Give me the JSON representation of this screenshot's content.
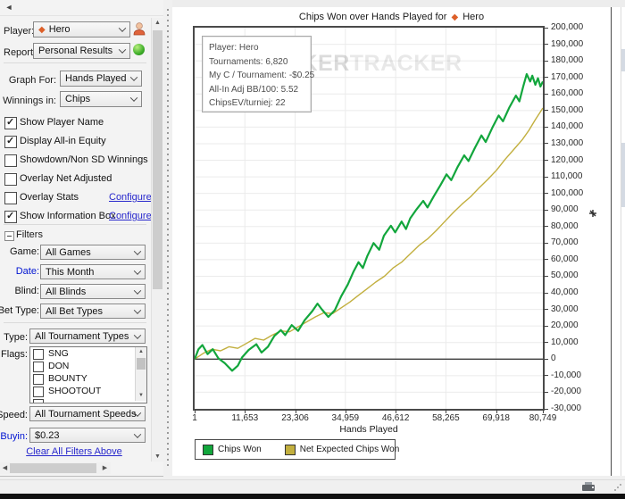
{
  "sidebar": {
    "collapse_button": "◄",
    "player": {
      "label": "Player:",
      "value": "Hero"
    },
    "report": {
      "label": "Report:",
      "value": "Personal Results"
    },
    "graph_for": {
      "label": "Graph For:",
      "value": "Hands Played"
    },
    "winnings_in": {
      "label": "Winnings in:",
      "value": "Chips"
    },
    "checkboxes": [
      {
        "label": "Show Player Name",
        "checked": true
      },
      {
        "label": "Display All-in Equity",
        "checked": true
      },
      {
        "label": "Showdown/Non SD Winnings",
        "checked": false
      },
      {
        "label": "Overlay Net Adjusted",
        "checked": false
      },
      {
        "label": "Overlay Stats",
        "checked": false,
        "link": "Configure"
      },
      {
        "label": "Show Information Box",
        "checked": true,
        "link": "Configure"
      }
    ],
    "filters": {
      "header": "Filters",
      "rows": [
        {
          "label": "Game:",
          "value": "All Games",
          "blue": false
        },
        {
          "label": "Date:",
          "value": "This Month",
          "blue": true
        },
        {
          "label": "Blind:",
          "value": "All Blinds",
          "blue": false
        },
        {
          "label": "Bet Type:",
          "value": "All Bet Types",
          "blue": false
        }
      ],
      "type": {
        "label": "Type:",
        "value": "All Tournament Types"
      },
      "flags": {
        "label": "Flags:",
        "items": [
          "SNG",
          "DON",
          "BOUNTY",
          "SHOOTOUT"
        ]
      },
      "speed": {
        "label": "Speed:",
        "value": "All Tournament Speeds"
      },
      "buyin": {
        "label": "Buyin:",
        "value": "$0.23"
      },
      "clear_link": "Clear All Filters Above"
    }
  },
  "chart": {
    "title_prefix": "Chips Won over Hands Played for",
    "title_player": "Hero",
    "watermark": {
      "part1": "P◉KER",
      "part2": "TRACKER"
    }
  },
  "info_box": {
    "lines": [
      "Player: Hero",
      "Tournaments: 6,820",
      "My C / Tournament: -$0.25",
      "All-In Adj BB/100: 5.52",
      "ChipsEV/turniej: 22"
    ]
  },
  "colors": {
    "green_line": "#12a63c",
    "yellow_line": "#c2af3e",
    "link_blue": "#2727cc",
    "label_blue": "#0014d2",
    "grid": "#ebebeb",
    "zero_line": "#3c3c3c"
  },
  "chart_data": {
    "type": "line",
    "title": "Chips Won over Hands Played for ◆ Hero",
    "xlabel": "Hands Played",
    "ylabel": "",
    "xlim": [
      1,
      80749
    ],
    "ylim": [
      -30000,
      200000
    ],
    "grid": true,
    "legend_position": "bottom-left",
    "x_ticks": [
      1,
      11653,
      23306,
      34959,
      46612,
      58265,
      69918,
      80749
    ],
    "x_tick_labels": [
      "1",
      "11,653",
      "23,306",
      "34,959",
      "46,612",
      "58,265",
      "69,918",
      "80,749"
    ],
    "y_tick_step": 10000,
    "y_tick_labels": [
      "200,000",
      "190,000",
      "180,000",
      "170,000",
      "160,000",
      "150,000",
      "140,000",
      "130,000",
      "120,000",
      "110,000",
      "100,000",
      "90,000",
      "80,000",
      "70,000",
      "60,000",
      "50,000",
      "40,000",
      "30,000",
      "20,000",
      "10,000",
      "0",
      "-10,000",
      "-20,000",
      "-30,000"
    ],
    "series": [
      {
        "name": "Chips Won",
        "color": "#12a63c",
        "width": 2.2,
        "points": [
          [
            1,
            0
          ],
          [
            900,
            6000
          ],
          [
            1800,
            8500
          ],
          [
            3000,
            3000
          ],
          [
            4200,
            6000
          ],
          [
            5500,
            500
          ],
          [
            7000,
            -2500
          ],
          [
            8700,
            -7000
          ],
          [
            10000,
            -4000
          ],
          [
            11000,
            1000
          ],
          [
            12500,
            5500
          ],
          [
            14300,
            9000
          ],
          [
            15500,
            4000
          ],
          [
            17000,
            7500
          ],
          [
            18500,
            14000
          ],
          [
            20000,
            17500
          ],
          [
            21000,
            14500
          ],
          [
            22500,
            20500
          ],
          [
            24000,
            17000
          ],
          [
            25500,
            23500
          ],
          [
            27300,
            29000
          ],
          [
            28500,
            33500
          ],
          [
            29500,
            30000
          ],
          [
            31000,
            25500
          ],
          [
            32500,
            29500
          ],
          [
            34000,
            38000
          ],
          [
            35500,
            45000
          ],
          [
            36800,
            52500
          ],
          [
            38000,
            58500
          ],
          [
            39000,
            55000
          ],
          [
            40000,
            62000
          ],
          [
            41500,
            70000
          ],
          [
            42800,
            66000
          ],
          [
            43900,
            74500
          ],
          [
            45500,
            80500
          ],
          [
            46500,
            76500
          ],
          [
            48000,
            83000
          ],
          [
            49000,
            78500
          ],
          [
            50000,
            85000
          ],
          [
            51500,
            90500
          ],
          [
            53000,
            95500
          ],
          [
            54000,
            91500
          ],
          [
            55500,
            98500
          ],
          [
            57000,
            105000
          ],
          [
            58400,
            111500
          ],
          [
            59500,
            108000
          ],
          [
            61000,
            116000
          ],
          [
            62500,
            123000
          ],
          [
            63500,
            119500
          ],
          [
            65000,
            127500
          ],
          [
            66500,
            135000
          ],
          [
            67500,
            131000
          ],
          [
            69000,
            139500
          ],
          [
            70500,
            147000
          ],
          [
            71500,
            143500
          ],
          [
            73000,
            152000
          ],
          [
            74500,
            159000
          ],
          [
            75300,
            155500
          ],
          [
            76200,
            164500
          ],
          [
            77000,
            172000
          ],
          [
            77800,
            167500
          ],
          [
            78300,
            171000
          ],
          [
            79000,
            165500
          ],
          [
            79600,
            169500
          ],
          [
            80200,
            164500
          ],
          [
            80749,
            167500
          ]
        ]
      },
      {
        "name": "Net Expected Chips Won",
        "color": "#c2af3e",
        "width": 1.4,
        "points": [
          [
            1,
            0
          ],
          [
            2000,
            3500
          ],
          [
            4000,
            6000
          ],
          [
            6000,
            5000
          ],
          [
            8000,
            7500
          ],
          [
            10000,
            6500
          ],
          [
            12000,
            9500
          ],
          [
            14000,
            12500
          ],
          [
            16000,
            11500
          ],
          [
            18000,
            14500
          ],
          [
            20000,
            17000
          ],
          [
            22000,
            16500
          ],
          [
            24000,
            19500
          ],
          [
            26000,
            22500
          ],
          [
            28000,
            25500
          ],
          [
            30000,
            28000
          ],
          [
            32000,
            27500
          ],
          [
            34000,
            31000
          ],
          [
            36000,
            34500
          ],
          [
            38000,
            38500
          ],
          [
            40000,
            42500
          ],
          [
            42000,
            46500
          ],
          [
            44000,
            50000
          ],
          [
            46000,
            55000
          ],
          [
            48000,
            58500
          ],
          [
            50000,
            63500
          ],
          [
            52000,
            68500
          ],
          [
            54000,
            72500
          ],
          [
            56000,
            77500
          ],
          [
            58000,
            83000
          ],
          [
            60000,
            88500
          ],
          [
            62000,
            93500
          ],
          [
            64000,
            98000
          ],
          [
            66000,
            103500
          ],
          [
            68000,
            108500
          ],
          [
            70000,
            114000
          ],
          [
            72000,
            120500
          ],
          [
            74000,
            126500
          ],
          [
            76000,
            132500
          ],
          [
            77500,
            138000
          ],
          [
            79000,
            144500
          ],
          [
            80000,
            148500
          ],
          [
            80749,
            151500
          ]
        ]
      }
    ]
  }
}
